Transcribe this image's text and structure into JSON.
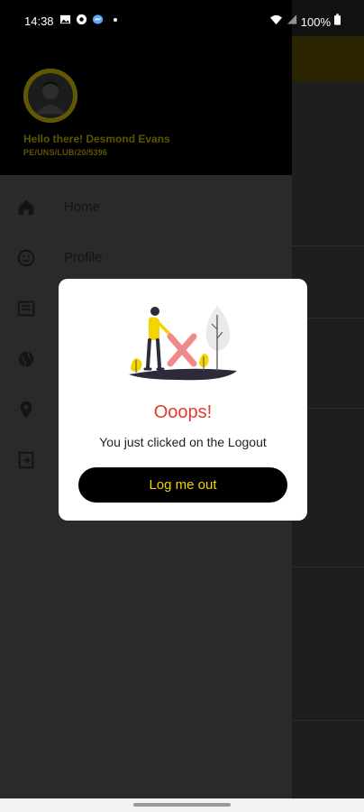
{
  "status_bar": {
    "time": "14:38",
    "battery": "100%"
  },
  "drawer": {
    "greeting": "Hello there! Desmond Evans",
    "user_id": "PE/UNS/LUB/20/5396",
    "items": [
      {
        "label": "Home",
        "icon": "home-icon"
      },
      {
        "label": "Profile",
        "icon": "profile-icon"
      },
      {
        "label": "",
        "icon": "list-icon"
      },
      {
        "label": "",
        "icon": "globe-icon"
      },
      {
        "label": "",
        "icon": "location-icon"
      },
      {
        "label": "",
        "icon": "logout-icon"
      }
    ]
  },
  "dialog": {
    "title": "Ooops!",
    "message": "You just clicked on the Logout",
    "button_label": "Log me out"
  },
  "colors": {
    "accent_yellow": "#F4D400",
    "title_red": "#E33A2B"
  }
}
